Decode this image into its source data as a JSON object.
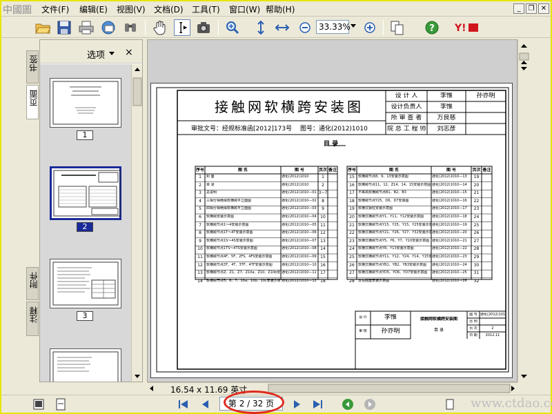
{
  "app": {
    "logo_text": "中國圖"
  },
  "menu": {
    "items": [
      "文件(F)",
      "编辑(E)",
      "视图(V)",
      "文档(D)",
      "工具(T)",
      "窗口(W)",
      "帮助(H)"
    ]
  },
  "toolbar": {
    "zoom_value": "33.33%",
    "icons": [
      "open-icon",
      "save-icon",
      "print-icon",
      "email-icon",
      "search-icon",
      "hand-tool-icon",
      "select-text-icon",
      "snapshot-icon",
      "zoom-in-icon",
      "fit-height-icon",
      "fit-width-icon",
      "zoom-out-minus-icon",
      "zoom-plus-icon",
      "pages-icon",
      "help-icon",
      "yahoo-icon"
    ]
  },
  "left_tabs": {
    "bookmarks": "书签",
    "pages": "页面",
    "attachments": "附件",
    "comments": "注释"
  },
  "thumbnails": {
    "options_label": "选项",
    "close": "×",
    "pages": [
      {
        "number": "1",
        "selected": false
      },
      {
        "number": "2",
        "selected": true
      },
      {
        "number": "3",
        "selected": false
      }
    ]
  },
  "document": {
    "title": "接触网软横跨安装图",
    "approval_no": "审批文号：经规标准函[2012]173号",
    "drawing_no": "图号：通化(2012)1010",
    "section_title": "目    录",
    "title_block": [
      {
        "role": "设  计  人",
        "name": "李惟",
        "sign": "孙亦明"
      },
      {
        "role": "设计负责人",
        "name": "李惟",
        "sign": ""
      },
      {
        "role": "所 审 查 者",
        "name": "万良慈",
        "sign": ""
      },
      {
        "role": "院 总 工 程 师",
        "name": "刘志彦",
        "sign": ""
      }
    ],
    "table_headers": [
      "序号",
      "图    名",
      "图    号",
      "页次",
      "备注"
    ],
    "left_rows": [
      [
        "1",
        "封 面",
        "通化(2012)1010",
        "1"
      ],
      [
        "2",
        "目 录",
        "通化(2012)1010",
        "2"
      ],
      [
        "3",
        "总说明",
        "通化(2012)1010—01",
        "3~7"
      ],
      [
        "4",
        "三相分相绝缘软横跨平立面图",
        "通化(2012)1010—02",
        "8"
      ],
      [
        "5",
        "四相分相绝缘软横跨平立面图",
        "通化(2012)1010—03",
        "9"
      ],
      [
        "6",
        "软横跨安装示意图",
        "通化(2012)1010—04",
        "10"
      ],
      [
        "7",
        "软横跨节点1～4安装示意图",
        "通化(2012)1010—05",
        "11"
      ],
      [
        "8",
        "软横跨节点1T～4T安装示意图",
        "通化(2012)1010—06",
        "12"
      ],
      [
        "9",
        "软横跨节点1S～4S安装示意图",
        "通化(2012)1010—07",
        "13"
      ],
      [
        "10",
        "软横跨节点1TS～4TS安装示意图",
        "通化(2012)1010—08",
        "14"
      ],
      [
        "11",
        "软横跨节点4F、5F、2FS、4FS安装示意图",
        "通化(2012)1010—09",
        "15"
      ],
      [
        "12",
        "软横跨节点3T、4T、3TF、4TF安装示意图",
        "通化(2012)1010—10",
        "16"
      ],
      [
        "13",
        "软横跨节点Z、Z1、Z7、Z10a、Z10、Z10b安装示意图",
        "通化(2012)1010—11",
        "17"
      ],
      [
        "14",
        "软横跨节点5、6、7、10a、10b、10c安装示意图",
        "通化(2012)1010—12",
        "18"
      ]
    ],
    "right_rows": [
      [
        "15",
        "软横跨节点8、9、13安装示意图",
        "通化(2012)1010—13",
        "19"
      ],
      [
        "16",
        "软横跨节点11、12、Z14、14、15安装示意图",
        "通化(2012)1010—14",
        "20"
      ],
      [
        "17",
        "不等高软横跨节点B1、B2、B3",
        "通化(2012)1010—15",
        "21"
      ],
      [
        "18",
        "软横跨节点Y25、D6、D7安装图",
        "通化(2012)1010—16",
        "22"
      ],
      [
        "19",
        "软横式钢柱安装示意图",
        "通化(2012)1010—17",
        "23"
      ],
      [
        "20",
        "软横式横跨节点Y1、Y11、Y12安装示意图",
        "通化(2012)1010—18",
        "24"
      ],
      [
        "21",
        "软横式横跨节点Y15、Y25、Y15、Y25安装示意图",
        "通化(2012)1010—19",
        "25"
      ],
      [
        "22",
        "软横式横跨节点Y21、Y26、Y27、Y32安装示意图",
        "通化(2012)1010—20",
        "26"
      ],
      [
        "23",
        "软横式横跨节点Y5、Y6、Y7、Y10安装示意图",
        "通化(2012)1010—21",
        "27"
      ],
      [
        "24",
        "软横式横跨节点Y8、Y13安装示意图",
        "通化(2012)1010—22",
        "28"
      ],
      [
        "25",
        "软横式横跨节点Y11、Y12、Y24、Y14、Y15安装示意图",
        "通化(2012)1010—23",
        "29"
      ],
      [
        "26",
        "软横式横跨节点YB1、YB2、YB3安装示意图",
        "通化(2012)1010—24",
        "30"
      ],
      [
        "27",
        "软横式横跨节点YD5、YD6、YD7安装示意图",
        "通化(2012)1010—25",
        "31"
      ],
      [
        "28",
        "支柱底座安装示意图",
        "通化(2012)1010—26",
        "32"
      ]
    ],
    "bottom_block": {
      "rows": [
        [
          "设 计",
          "李惟"
        ],
        [
          "审 核",
          "孙亦明"
        ]
      ],
      "center": "接触网软横跨安装图",
      "center_sub": "目 录",
      "right_rows": [
        [
          "图 号",
          "通化(2012)1010"
        ],
        [
          "比 例",
          ""
        ],
        [
          "页 次",
          "2"
        ],
        [
          "日 期",
          "2012.11"
        ]
      ]
    },
    "page_size": "16.54 x 11.69 英寸"
  },
  "navigation": {
    "page_indicator": "第 2 / 32 页",
    "watermark": "www.ctdao.com"
  }
}
